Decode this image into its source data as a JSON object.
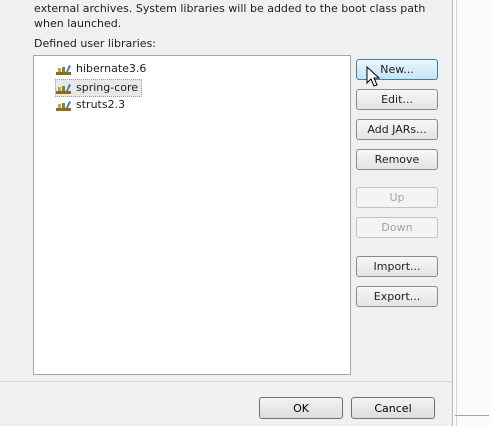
{
  "description": "external archives. System libraries will be added to the boot class path\nwhen launched.",
  "list_label": "Defined user libraries:",
  "libraries": [
    {
      "name": "hibernate3.6",
      "icon": "jar-library-icon"
    },
    {
      "name": "spring-core",
      "icon": "jar-library-icon",
      "selected": true
    },
    {
      "name": "struts2.3",
      "icon": "jar-library-icon"
    }
  ],
  "buttons": {
    "new": "New...",
    "edit": "Edit...",
    "add_jars": "Add JARs...",
    "remove": "Remove",
    "up": "Up",
    "down": "Down",
    "import": "Import...",
    "export": "Export..."
  },
  "footer": {
    "ok": "OK",
    "cancel": "Cancel"
  },
  "colors": {
    "focus_border": "#3c7fb1",
    "jar_icon": "#8a6d1e"
  }
}
